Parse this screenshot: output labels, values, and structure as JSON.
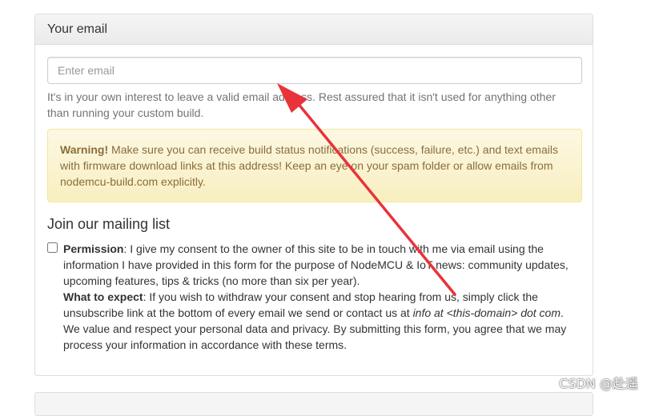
{
  "panel": {
    "heading": "Your email",
    "email_placeholder": "Enter email",
    "email_value": "",
    "help_text": "It's in your own interest to leave a valid email address. Rest assured that it isn't used for anything other than running your custom build.",
    "warning": {
      "label": "Warning!",
      "text": " Make sure you can receive build status notifications (success, failure, etc.) and text emails with firmware download links at this address! Keep an eye on your spam folder or allow emails from nodemcu-build.com explicitly."
    },
    "mailing_title": "Join our mailing list",
    "permission": {
      "label": "Permission",
      "text": ": I give my consent to the owner of this site to be in touch with me via email using the information I have provided in this form for the purpose of NodeMCU & IoT news: community updates, upcoming features, tips & tricks (no more than six per year).",
      "checked": false
    },
    "expect": {
      "label": "What to expect",
      "text_before": ": If you wish to withdraw your consent and stop hearing from us, simply click the unsubscribe link at the bottom of every email we send or contact us at ",
      "contact": "info at <this-domain> dot com",
      "text_after": ". We value and respect your personal data and privacy. By submitting this form, you agree that we may process your information in accordance with these terms."
    }
  },
  "watermark": "CSDN @赴遥",
  "colors": {
    "arrow": "#e8333a",
    "warning_text": "#8a6d3b",
    "warning_bg": "#fcf8e3"
  }
}
